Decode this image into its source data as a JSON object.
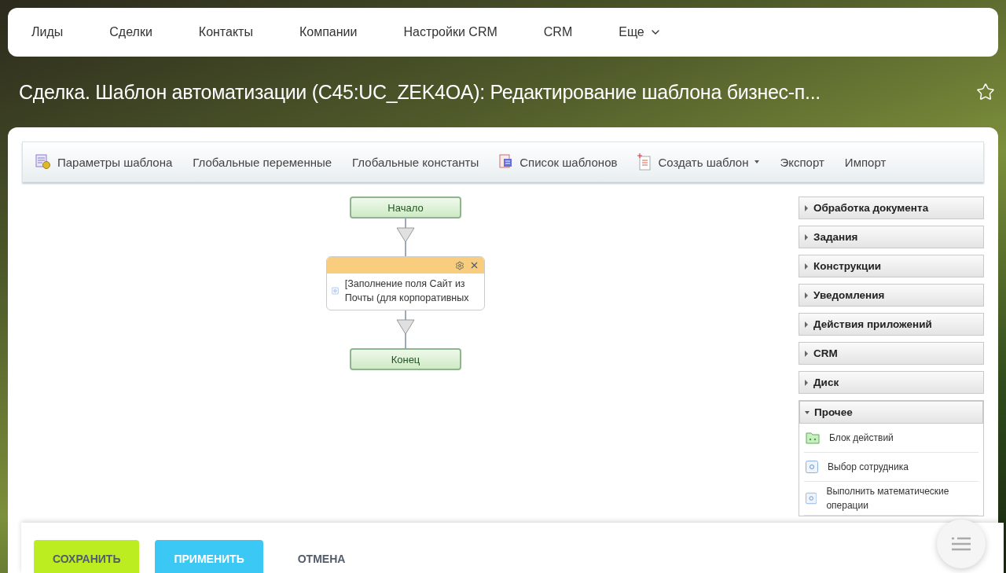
{
  "nav": [
    {
      "label": "Лиды",
      "has_menu": false
    },
    {
      "label": "Сделки",
      "has_menu": false
    },
    {
      "label": "Контакты",
      "has_menu": false
    },
    {
      "label": "Компании",
      "has_menu": false
    },
    {
      "label": "Настройки CRM",
      "has_menu": false
    },
    {
      "label": "CRM",
      "has_menu": false
    },
    {
      "label": "Еще",
      "has_menu": true
    }
  ],
  "title": "Сделка. Шаблон автоматизации (C45:UC_ZEK4OA): Редактирование шаблона бизнес-п...",
  "starred": false,
  "toolbar": [
    {
      "label": "Параметры шаблона",
      "kind": "settings",
      "has_menu": false
    },
    {
      "label": "Глобальные переменные",
      "kind": "plain",
      "has_menu": false
    },
    {
      "label": "Глобальные константы",
      "kind": "plain",
      "has_menu": false
    },
    {
      "label": "Список шаблонов",
      "kind": "list",
      "has_menu": false
    },
    {
      "label": "Создать шаблон",
      "kind": "new",
      "has_menu": true
    },
    {
      "label": "Экспорт",
      "kind": "plain",
      "has_menu": false
    },
    {
      "label": "Импорт",
      "kind": "plain",
      "has_menu": false
    }
  ],
  "workflow": [
    {
      "kind": "terminal",
      "label": "Начало"
    },
    {
      "kind": "activity",
      "label": "[Заполнение поля Сайт из Почты (для корпоративных"
    },
    {
      "kind": "terminal",
      "label": "Конец"
    }
  ],
  "groups": [
    {
      "label": "Обработка документа",
      "expanded": false
    },
    {
      "label": "Задания",
      "expanded": false
    },
    {
      "label": "Конструкции",
      "expanded": false
    },
    {
      "label": "Уведомления",
      "expanded": false
    },
    {
      "label": "Действия приложений",
      "expanded": false
    },
    {
      "label": "CRM",
      "expanded": false
    },
    {
      "label": "Диск",
      "expanded": false
    },
    {
      "label": "Прочее",
      "expanded": true,
      "items": [
        {
          "label": "Блок действий",
          "kind": "block"
        },
        {
          "label": "Выбор сотрудника",
          "kind": "activity"
        },
        {
          "label": "Выполнить математические операции",
          "kind": "activity"
        }
      ]
    }
  ],
  "footer": [
    {
      "label": "СОХРАНИТЬ",
      "kind": "save"
    },
    {
      "label": "ПРИМЕНИТЬ",
      "kind": "apply"
    },
    {
      "label": "ОТМЕНА",
      "kind": "cancel"
    }
  ]
}
